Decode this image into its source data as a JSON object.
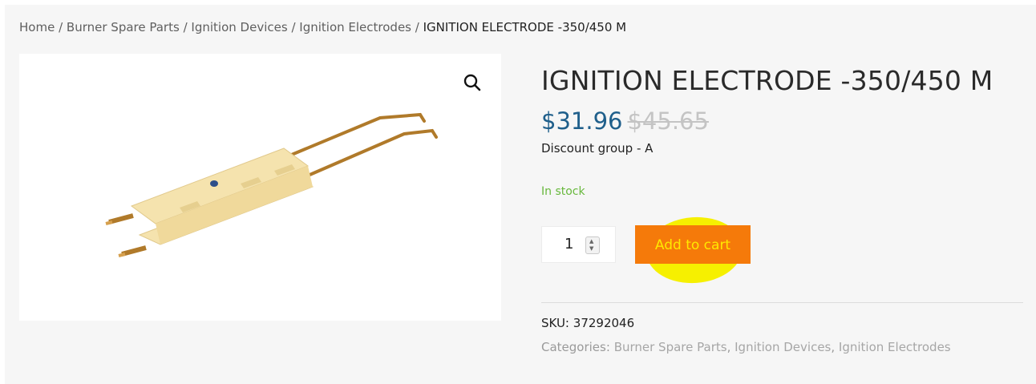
{
  "breadcrumb": {
    "home": "Home",
    "separator": "/",
    "level1": "Burner Spare Parts",
    "level2": "Ignition Devices",
    "level3": "Ignition Electrodes",
    "current": "IGNITION ELECTRODE -350/450 M"
  },
  "product": {
    "title": "IGNITION ELECTRODE -350/450 M",
    "price_current": "$31.96",
    "price_old": "$45.65",
    "discount": "Discount group - A",
    "stock": "In stock",
    "quantity": "1",
    "add_to_cart_label": "Add to cart",
    "sku_label": "SKU:",
    "sku_value": "37292046",
    "categories_label": "Categories:",
    "categories": [
      "Burner Spare Parts",
      "Ignition Devices",
      "Ignition Electrodes"
    ],
    "categories_separator": ","
  },
  "icons": {
    "zoom": "magnifier-icon",
    "spinner_up": "caret-up-icon",
    "spinner_down": "caret-down-icon"
  },
  "colors": {
    "price": "#1f5f8b",
    "stock": "#67b83c",
    "button_bg": "#f57a0a",
    "button_text": "#ffe800",
    "highlight": "#f6f000"
  }
}
